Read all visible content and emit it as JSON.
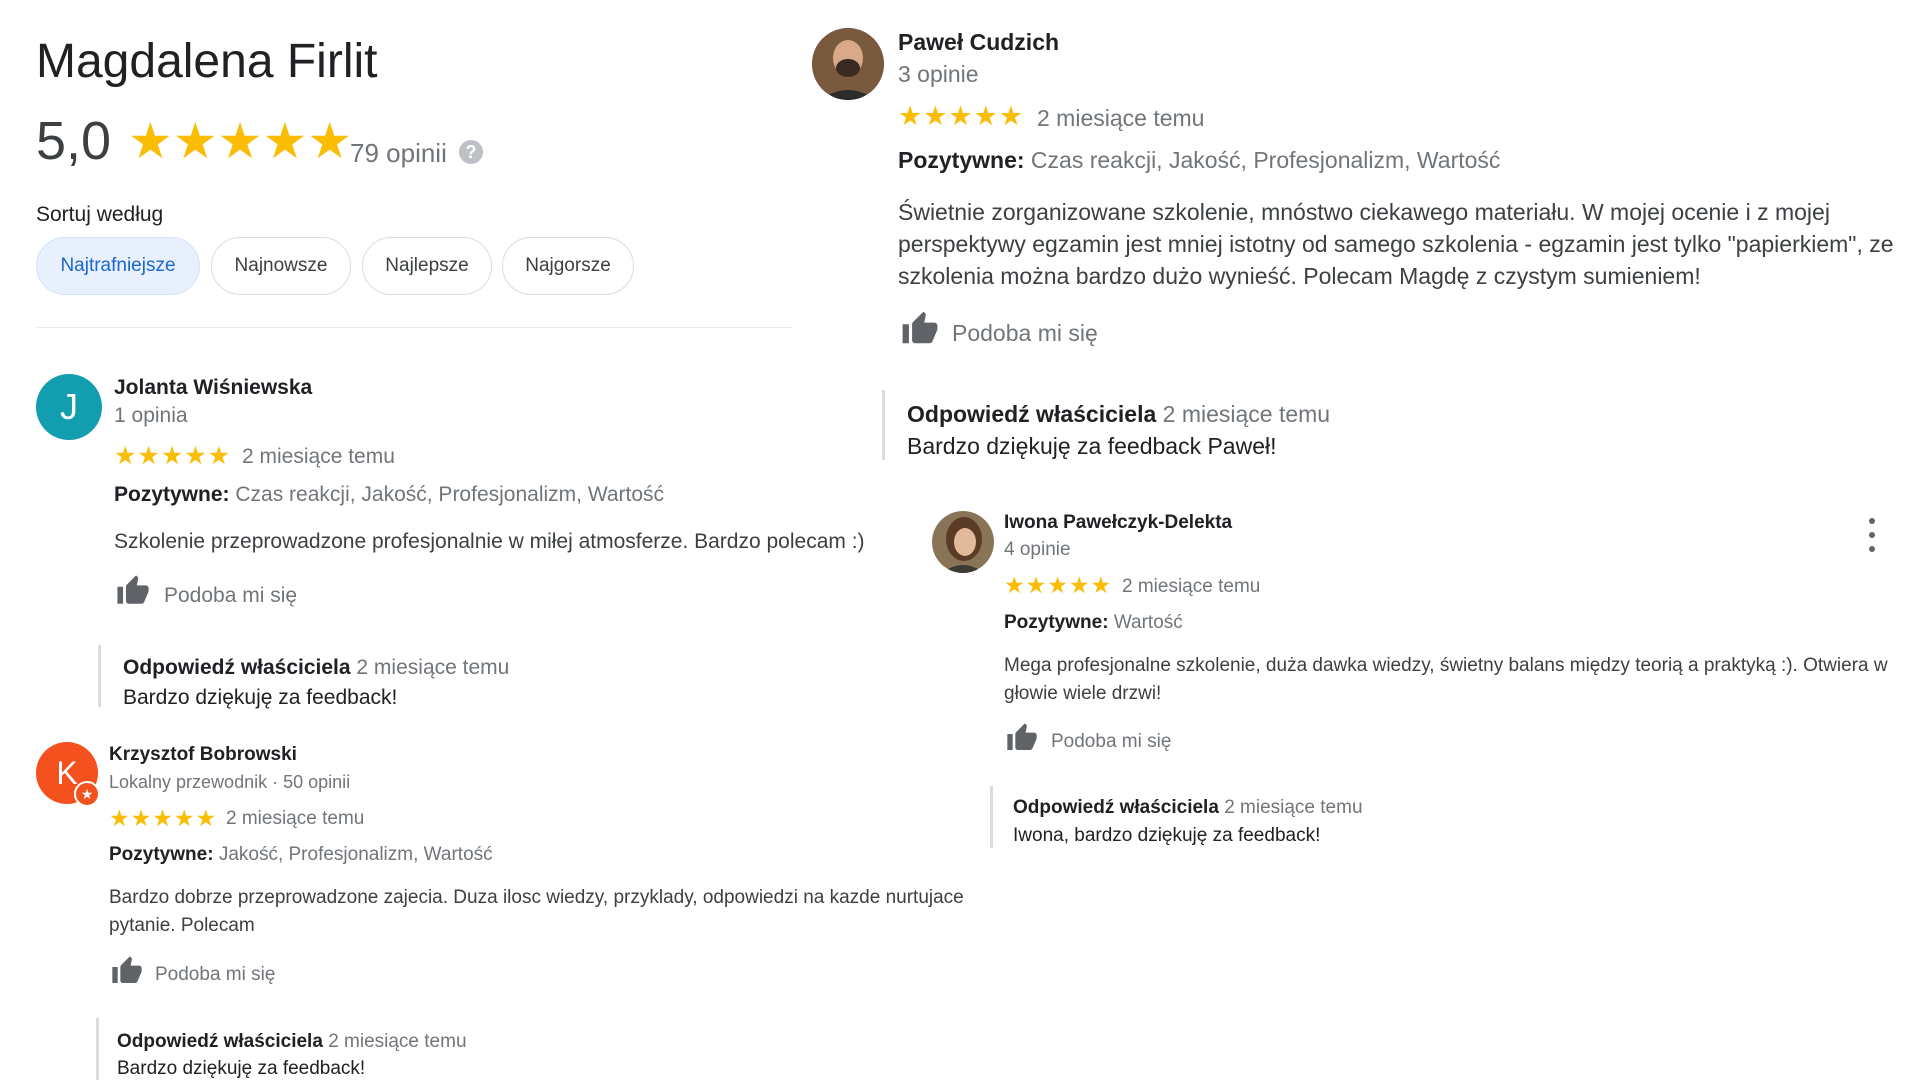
{
  "place": {
    "title": "Magdalena Firlit",
    "rating": "5,0",
    "rating_stars": "★★★★★",
    "review_count": "79 opinii",
    "help_icon": "question-mark-icon"
  },
  "sort": {
    "label": "Sortuj według",
    "options": [
      "Najtrafniejsze",
      "Najnowsze",
      "Najlepsze",
      "Najgorsze"
    ],
    "selected": "Najtrafniejsze"
  },
  "colors": {
    "star": "#fbbc04",
    "chip_active_bg": "#e8f0fe",
    "chip_active_text": "#1967d2",
    "avatar_jolanta": "#129eaf",
    "avatar_krzysztof": "#f4511e"
  },
  "common": {
    "positive_label": "Pozytywne:",
    "like_label": "Podoba mi się",
    "like_icon": "thumbs-up-icon",
    "owner_label": "Odpowiedź właściciela",
    "more_icon": "more-vert-icon",
    "stars": "★★★★★"
  },
  "reviews": [
    {
      "name": "Jolanta Wiśniewska",
      "meta": "1 opinia",
      "initial": "J",
      "time": "2 miesiące temu",
      "positives": "Czas reakcji, Jakość, Profesjonalizm, Wartość",
      "text": "Szkolenie przeprowadzone profesjonalnie w miłej atmosferze. Bardzo polecam :)",
      "owner_time": "2 miesiące temu",
      "owner_reply": "Bardzo dziękuję za feedback!"
    },
    {
      "name": "Krzysztof Bobrowski",
      "meta": "Lokalny przewodnik · 50 opinii",
      "initial": "K",
      "time": "2 miesiące temu",
      "positives": "Jakość, Profesjonalizm, Wartość",
      "text": "Bardzo dobrze przeprowadzone zajecia. Duza ilosc wiedzy, przyklady, odpowiedzi na kazde nurtujace pytanie. Polecam",
      "owner_time": "2 miesiące temu",
      "owner_reply": "Bardzo dziękuję za feedback!"
    },
    {
      "name": "Paweł Cudzich",
      "meta": "3 opinie",
      "time": "2 miesiące temu",
      "positives": "Czas reakcji, Jakość, Profesjonalizm, Wartość",
      "text": "Świetnie zorganizowane szkolenie, mnóstwo ciekawego materiału. W mojej ocenie i z mojej perspektywy egzamin jest mniej istotny od samego szkolenia - egzamin jest tylko \"papierkiem\", ze szkolenia można bardzo dużo wynieść. Polecam Magdę z czystym sumieniem!",
      "owner_time": "2 miesiące temu",
      "owner_reply": "Bardzo dziękuję za feedback Paweł!"
    },
    {
      "name": "Iwona Pawełczyk-Delekta",
      "meta": "4 opinie",
      "time": "2 miesiące temu",
      "positives": "Wartość",
      "text": "Mega profesjonalne szkolenie, duża dawka wiedzy, świetny balans między teorią a praktyką :). Otwiera w głowie wiele drzwi!",
      "owner_time": "2 miesiące temu",
      "owner_reply": "Iwona, bardzo dziękuję za feedback!"
    }
  ]
}
